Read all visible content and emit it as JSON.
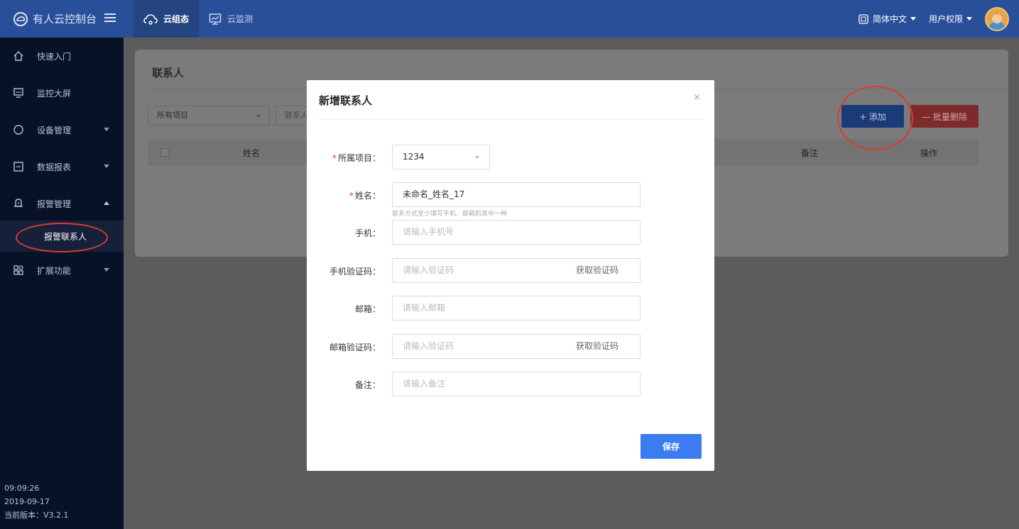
{
  "brand": {
    "name": "有人云控制台"
  },
  "topnav": [
    {
      "label": "云组态"
    },
    {
      "label": "云监测"
    }
  ],
  "topright": {
    "language": "简体中文",
    "permissions": "用户权限"
  },
  "sidebar": {
    "items": [
      {
        "label": "快速入门",
        "icon": "home-icon"
      },
      {
        "label": "监控大屏",
        "icon": "monitor-icon"
      },
      {
        "label": "设备管理",
        "icon": "device-icon"
      },
      {
        "label": "数据报表",
        "icon": "report-icon"
      },
      {
        "label": "报警管理",
        "icon": "bell-icon"
      },
      {
        "label": "扩展功能",
        "icon": "apps-icon"
      }
    ],
    "sub_item": "报警联系人",
    "footer": {
      "time": "09:09:26",
      "date": "2019-09-17",
      "version": "当前版本：V3.2.1"
    }
  },
  "card": {
    "title": "联系人",
    "filter_select": "所有项目",
    "filter_input": "联系人",
    "add_button": "+ 添加",
    "delete_button": "— 批量删除",
    "columns": {
      "name": "姓名",
      "remark": "备注",
      "actions": "操作"
    }
  },
  "modal": {
    "title": "新增联系人",
    "close": "×",
    "hint": "联系方式至少填写手机、邮箱的其中一种",
    "fields": {
      "project": {
        "label": "所属项目：",
        "value": "1234"
      },
      "name": {
        "label": "姓名：",
        "value": "未命名_姓名_17"
      },
      "phone": {
        "label": "手机：",
        "placeholder": "请输入手机号"
      },
      "phone_code": {
        "label": "手机验证码：",
        "placeholder": "请输入验证码",
        "button": "获取验证码"
      },
      "email": {
        "label": "邮箱：",
        "placeholder": "请输入邮箱"
      },
      "email_code": {
        "label": "邮箱验证码：",
        "placeholder": "请输入验证码",
        "button": "获取验证码"
      },
      "remark": {
        "label": "备注：",
        "placeholder": "请输入备注"
      }
    },
    "save": "保存"
  },
  "colors": {
    "topbar": "#2a4f99",
    "sidebar": "#081226",
    "primary": "#3b7cf0",
    "danger": "#d83c34"
  }
}
